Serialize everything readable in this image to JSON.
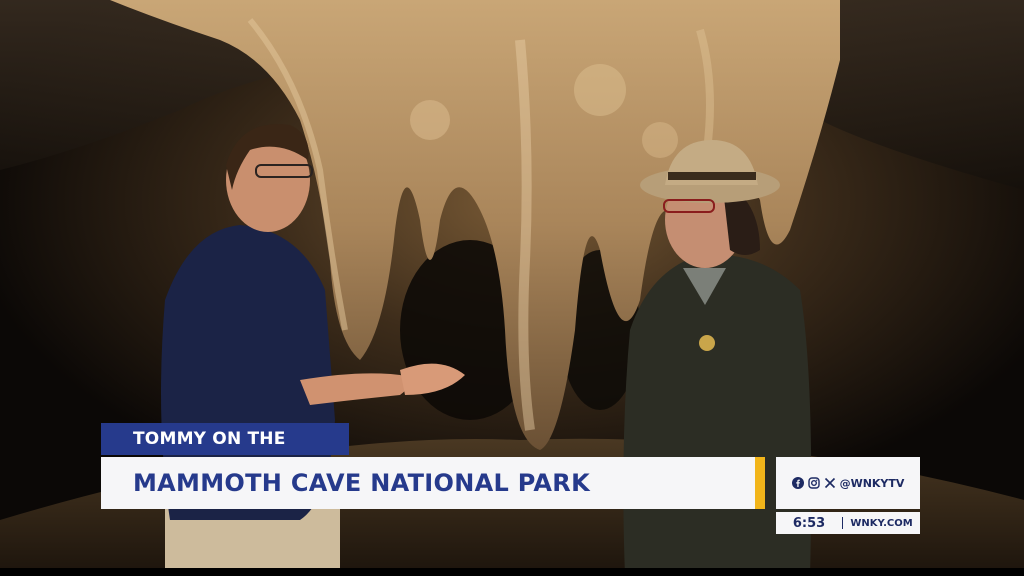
{
  "lower_third": {
    "kicker": "TOMMY ON THE TOWN",
    "headline": "MAMMOTH CAVE NATIONAL PARK",
    "accent_color": "#f2b51a",
    "primary_color": "#263a8c"
  },
  "social": {
    "icons": [
      "facebook-icon",
      "instagram-icon",
      "x-icon"
    ],
    "handle": "@WNKYTV"
  },
  "clock": {
    "time": "6:53",
    "website": "WNKY.COM"
  },
  "scene": {
    "description_icons": [
      "cave-background",
      "stalactite-column",
      "reporter",
      "park-ranger"
    ]
  }
}
